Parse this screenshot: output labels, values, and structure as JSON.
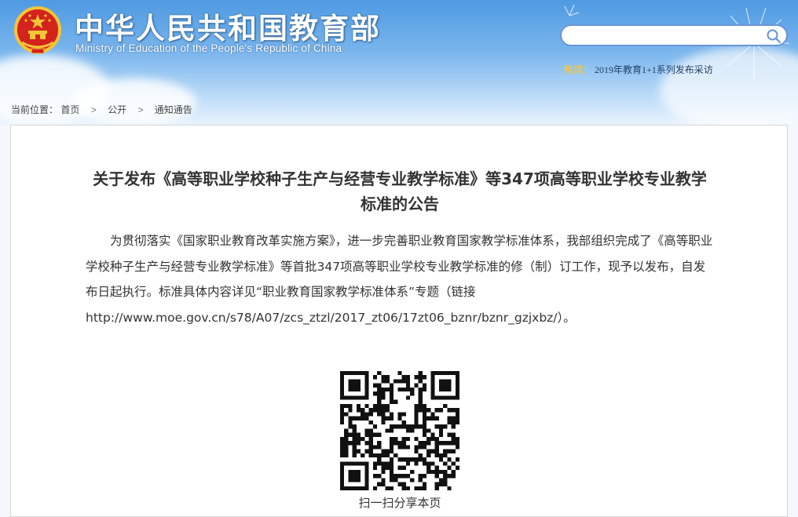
{
  "header": {
    "site_title": "中华人民共和国教育部",
    "site_subtitle": "Ministry of Education of the People's Republic of China",
    "search": {
      "placeholder": "",
      "value": ""
    },
    "hot_label": "热词",
    "hot_sep": "：",
    "hot_link": "2019年教育1+1系列发布采访"
  },
  "breadcrumb": {
    "prefix": "当前位置：",
    "items": [
      "首页",
      "公开",
      "通知通告"
    ],
    "separator": ">"
  },
  "article": {
    "title": "关于发布《高等职业学校种子生产与经营专业教学标准》等347项高等职业学校专业教学标准的公告",
    "body": "为贯彻落实《国家职业教育改革实施方案》，进一步完善职业教育国家教学标准体系，我部组织完成了《高等职业学校种子生产与经营专业教学标准》等首批347项高等职业学校专业教学标准的修（制）订工作，现予以发布，自发布日起执行。标准具体内容详见“职业教育国家教学标准体系”专题（链接http://www.moe.gov.cn/s78/A07/zcs_ztzl/2017_zt06/17zt06_bznr/bznr_gzjxbz/）。",
    "qr_caption": "扫一扫分享本页"
  },
  "colors": {
    "search_border": "#6a95d8",
    "hot_label": "#f7c63a",
    "sky_top": "#4f9ae2"
  }
}
